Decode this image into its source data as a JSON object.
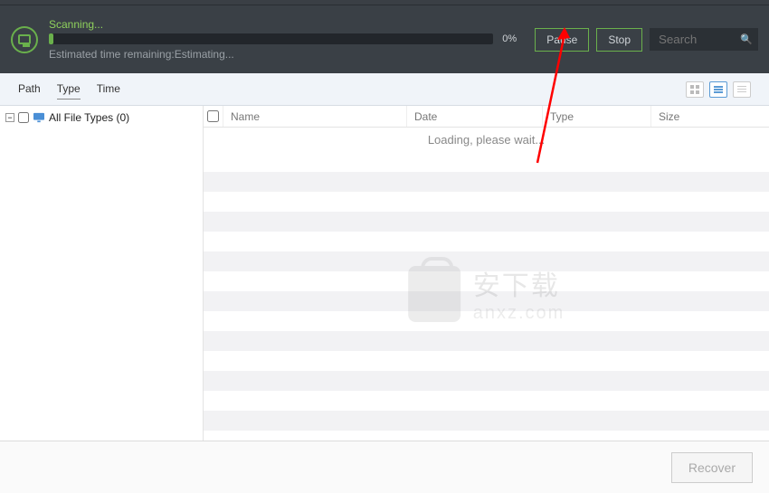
{
  "scan": {
    "status": "Scanning...",
    "progress_pct": "0%",
    "eta": "Estimated time remaining:Estimating...",
    "pause_label": "Pause",
    "stop_label": "Stop"
  },
  "search": {
    "placeholder": "Search"
  },
  "tabs": {
    "path": "Path",
    "type": "Type",
    "time": "Time"
  },
  "tree": {
    "root_label": "All File Types (0)"
  },
  "table": {
    "columns": {
      "name": "Name",
      "date": "Date",
      "type": "Type",
      "size": "Size"
    },
    "loading": "Loading, please wait..."
  },
  "watermark": {
    "line1": "安下载",
    "line2": "anxz.com"
  },
  "footer": {
    "recover": "Recover"
  }
}
